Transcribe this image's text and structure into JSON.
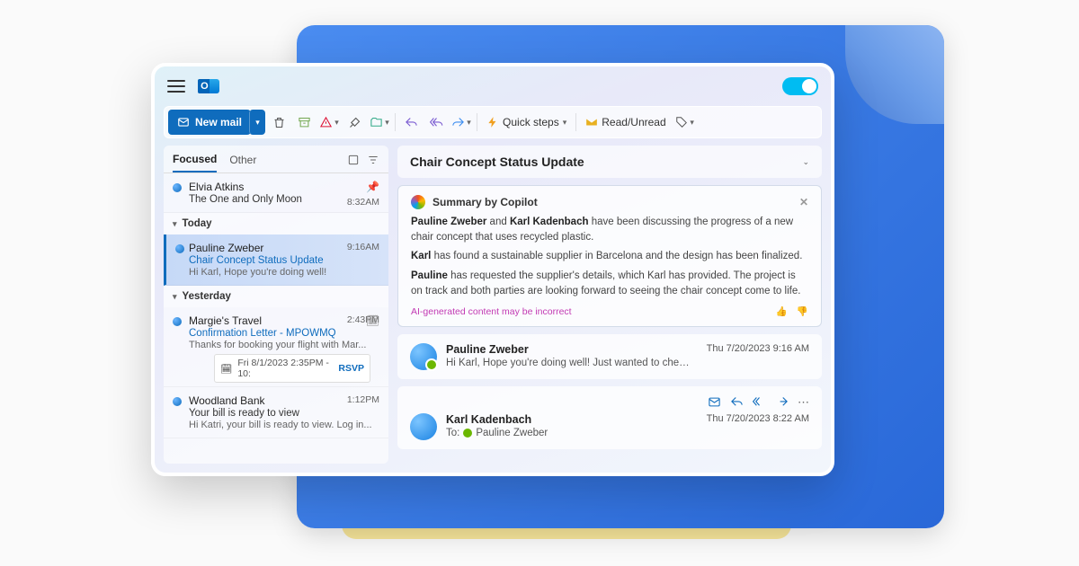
{
  "toolbar": {
    "new_mail": "New mail",
    "quick_steps": "Quick steps",
    "read_unread": "Read/Unread"
  },
  "tabs": {
    "focused": "Focused",
    "other": "Other"
  },
  "groups": {
    "today": "Today",
    "yesterday": "Yesterday"
  },
  "mail": {
    "m1": {
      "sender": "Elvia Atkins",
      "subject": "The One and Only Moon",
      "time": "8:32AM"
    },
    "m2": {
      "sender": "Pauline Zweber",
      "subject": "Chair Concept Status Update",
      "preview": "Hi Karl, Hope you're doing well!",
      "time": "9:16AM"
    },
    "m3": {
      "sender": "Margie's Travel",
      "subject": "Confirmation Letter - MPOWMQ",
      "preview": "Thanks for booking your flight with Mar...",
      "time": "2:43PM"
    },
    "m3_rsvp_date": "Fri 8/1/2023 2:35PM - 10:",
    "m3_rsvp": "RSVP",
    "m4": {
      "sender": "Woodland Bank",
      "subject": "Your bill is ready to view",
      "preview": "Hi Katri, your bill is ready to view. Log in...",
      "time": "1:12PM"
    }
  },
  "reading": {
    "subject": "Chair Concept Status Update",
    "copilot_title": "Summary by Copilot",
    "copilot_p1_a": "Pauline Zweber",
    "copilot_p1_b": " and ",
    "copilot_p1_c": "Karl Kadenbach",
    "copilot_p1_d": " have been discussing the progress of a new chair concept that uses recycled plastic.",
    "copilot_p2_a": "Karl",
    "copilot_p2_b": " has found a sustainable supplier in Barcelona and the design has been finalized.",
    "copilot_p3_a": "Pauline",
    "copilot_p3_b": " has requested the supplier's details, which Karl has provided. The project is on track and both parties are looking forward to seeing the chair concept come to life.",
    "copilot_disclaimer": "AI-generated content may be incorrect",
    "msg1": {
      "name": "Pauline Zweber",
      "preview": "Hi Karl, Hope you're doing well!  Just wanted to check in on the progres...",
      "date": "Thu 7/20/2023 9:16 AM"
    },
    "msg2": {
      "name": "Karl Kadenbach",
      "to_label": "To:",
      "to_name": "Pauline Zweber",
      "date": "Thu 7/20/2023 8:22 AM"
    }
  }
}
